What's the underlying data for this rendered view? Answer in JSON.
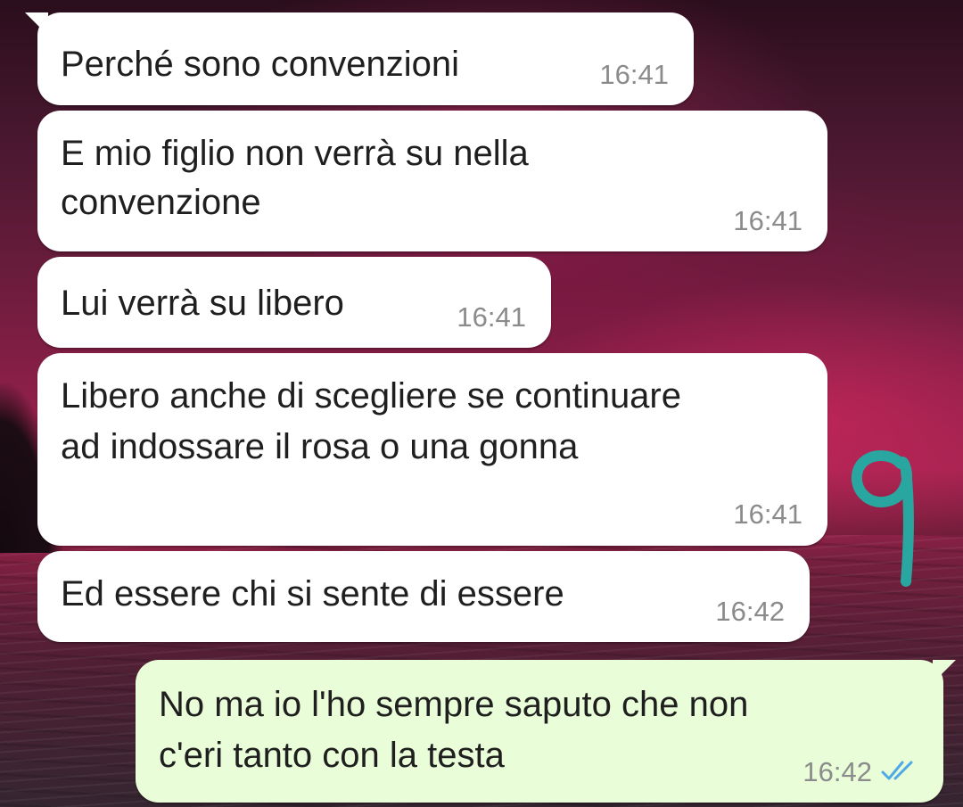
{
  "chat": {
    "messages": [
      {
        "direction": "incoming",
        "text_lines": [
          "Perché sono convenzioni"
        ],
        "time": "16:41"
      },
      {
        "direction": "incoming",
        "text_lines": [
          "E mio figlio non verrà su nella",
          "convenzione"
        ],
        "time": "16:41"
      },
      {
        "direction": "incoming",
        "text_lines": [
          "Lui verrà su libero"
        ],
        "time": "16:41"
      },
      {
        "direction": "incoming",
        "text_lines": [
          "Libero anche di scegliere se continuare",
          "ad indossare il rosa o una gonna"
        ],
        "time": "16:41"
      },
      {
        "direction": "incoming",
        "text_lines": [
          "Ed essere chi si sente di essere"
        ],
        "time": "16:42"
      },
      {
        "direction": "outgoing",
        "text_lines": [
          "No ma io l'ho sempre saputo che non",
          "c'eri tanto con la testa"
        ],
        "time": "16:42",
        "status": "read"
      }
    ]
  },
  "annotation": {
    "glyph": "9",
    "color": "#2aa6a0"
  },
  "colors": {
    "incoming_bubble": "#ffffff",
    "outgoing_bubble": "#e9fdd8",
    "timestamp": "#8b8b8b",
    "read_ticks": "#4fa9e6"
  },
  "icons": {
    "read_status": "double-check-icon"
  }
}
